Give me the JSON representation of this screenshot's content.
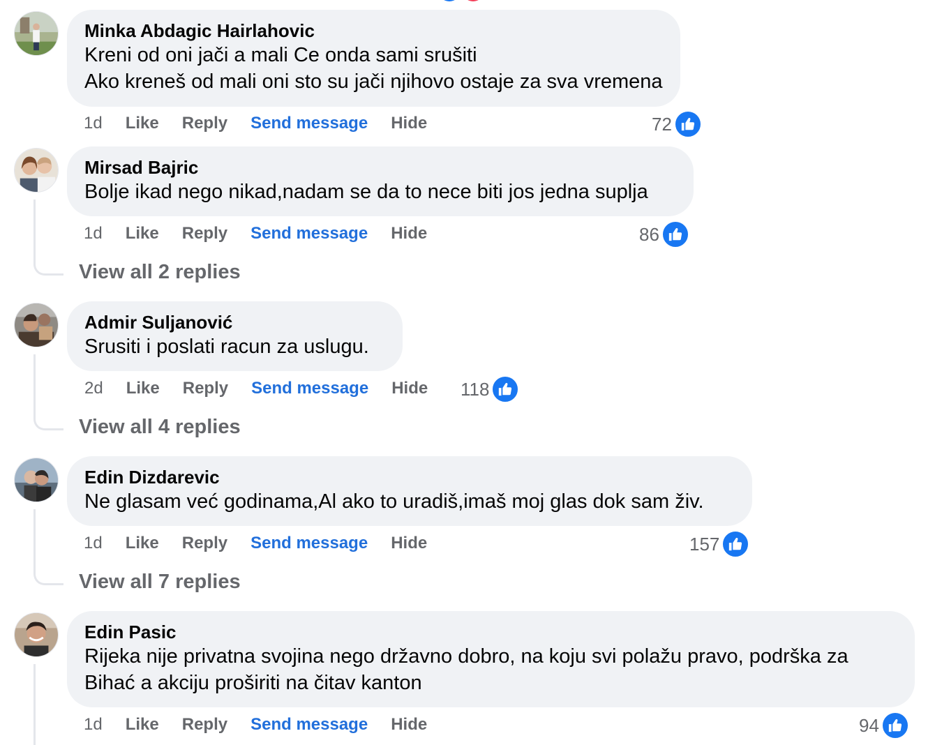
{
  "colors": {
    "bubble": "#f0f2f5",
    "link": "#216fdb",
    "like": "#1877f2",
    "muted": "#65676b"
  },
  "actions": {
    "like": "Like",
    "reply": "Reply",
    "send_message": "Send message",
    "hide": "Hide"
  },
  "comments": [
    {
      "author": "Minka Abdagic Hairlahovic",
      "text": "Kreni od oni jači a mali Ce onda sami srušiti\nAko kreneš od mali oni sto su jači njihovo ostaje za sva vremena",
      "time": "1d",
      "reactions": "72"
    },
    {
      "author": "Mirsad Bajric",
      "text": "Bolje ikad nego nikad,nadam se da to nece biti jos jedna suplja",
      "time": "1d",
      "reactions": "86",
      "view_replies": "View all 2 replies"
    },
    {
      "author": "Admir Suljanović",
      "text": "Srusiti i poslati racun za uslugu.",
      "time": "2d",
      "reactions": "118",
      "view_replies": "View all 4 replies"
    },
    {
      "author": "Edin Dizdarevic",
      "text": "Ne glasam već godinama,Al ako to uradiš,imaš moj glas dok sam živ.",
      "time": "1d",
      "reactions": "157",
      "view_replies": "View all 7 replies"
    },
    {
      "author": "Edin Pasic",
      "text": "Rijeka nije privatna svojina nego državno dobro, na koju svi polažu pravo, podrška za\nBihać a akciju proširiti na čitav kanton",
      "time": "1d",
      "reactions": "94"
    }
  ]
}
